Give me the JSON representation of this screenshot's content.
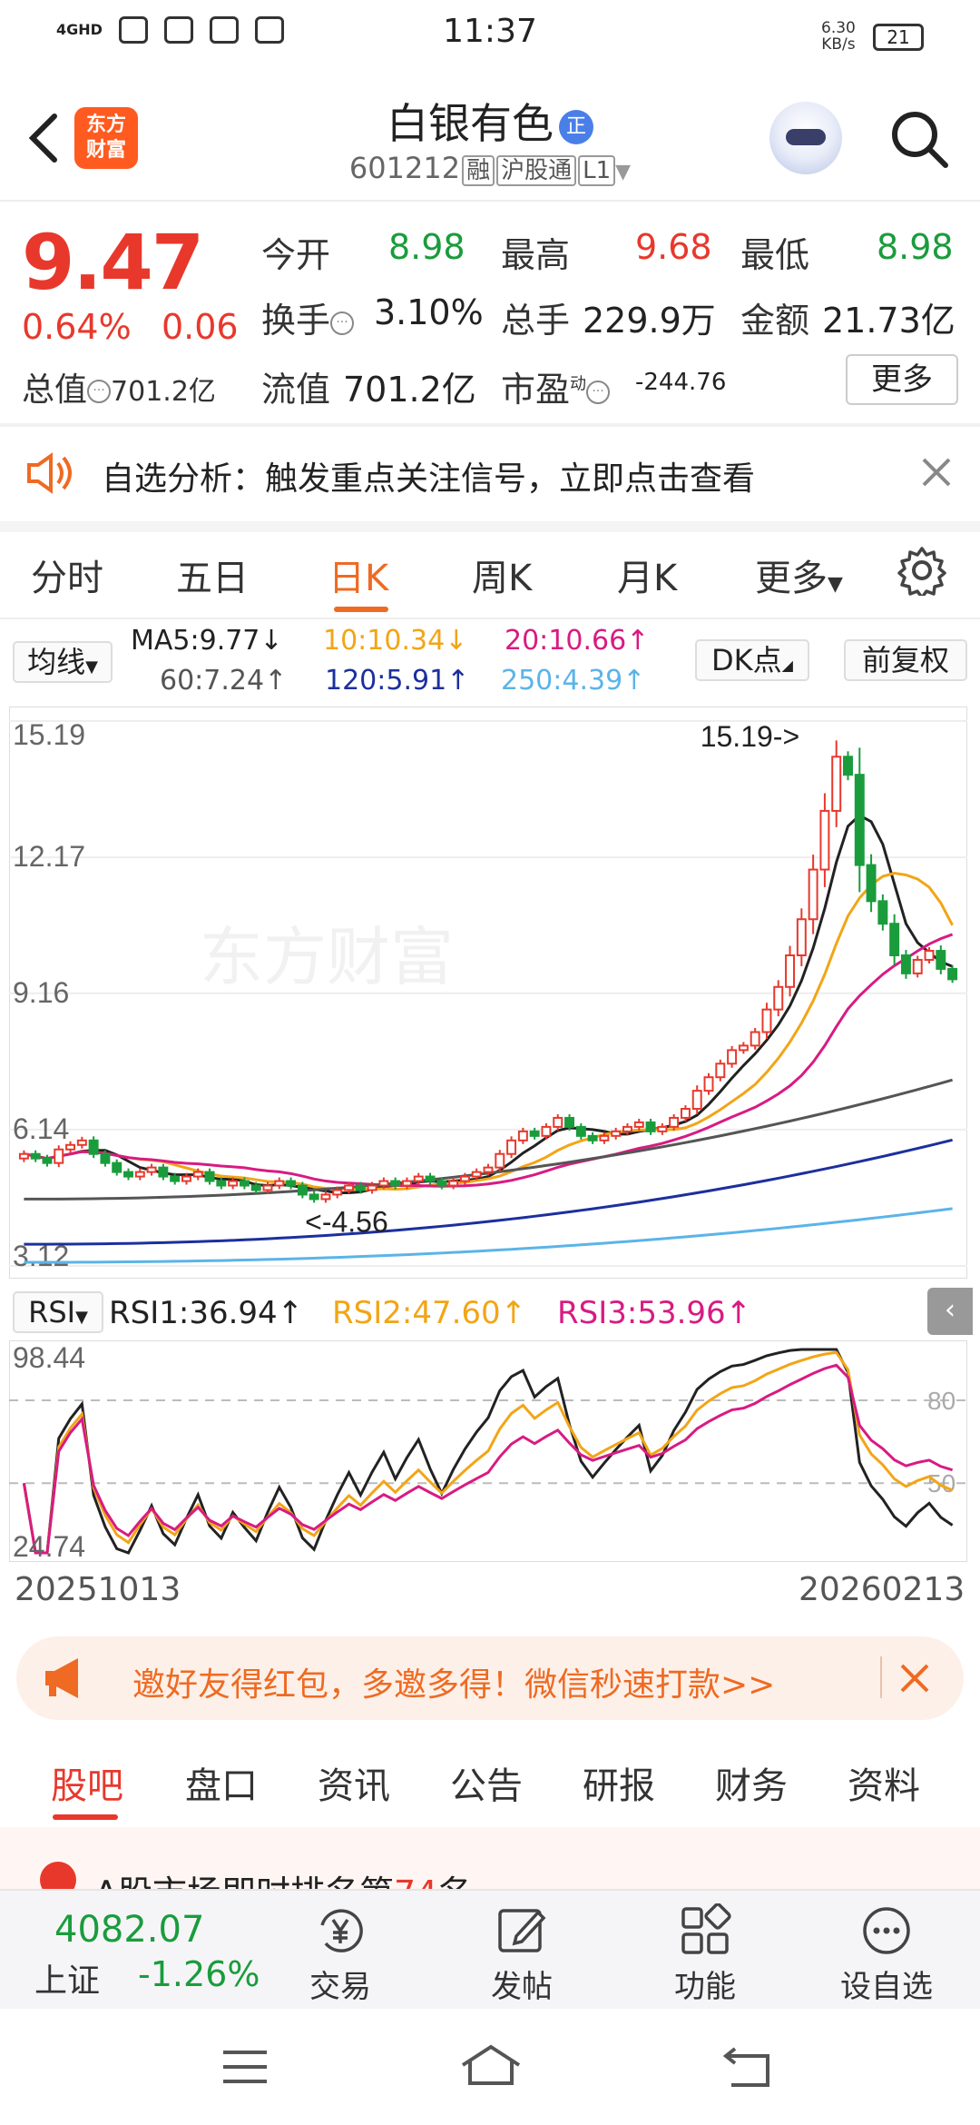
{
  "status_bar": {
    "time": "11:37",
    "net_speed": "6.30",
    "net_unit": "KB/s",
    "battery": "21",
    "signal": "4GHD"
  },
  "header": {
    "stock_name": "白银有色",
    "badge": "正",
    "code": "601212",
    "tags": [
      "融",
      "沪股通",
      "L1"
    ],
    "logo_text": [
      "东方",
      "财富"
    ]
  },
  "quote": {
    "price": "9.47",
    "change_pct": "0.64%",
    "change": "0.06",
    "rows": [
      [
        {
          "label": "今开",
          "value": "8.98",
          "color": "green"
        },
        {
          "label": "最高",
          "value": "9.68",
          "color": "red"
        },
        {
          "label": "最低",
          "value": "8.98",
          "color": "green"
        }
      ],
      [
        {
          "label": "换手",
          "value": "3.10%",
          "color": "dark"
        },
        {
          "label": "总手",
          "value": "229.9万",
          "color": "dark"
        },
        {
          "label": "金额",
          "value": "21.73亿",
          "color": "dark"
        }
      ],
      [
        {
          "label": "总值",
          "value": "701.2亿"
        },
        {
          "label": "流值",
          "value": "701.2亿"
        },
        {
          "label": "市盈",
          "value": "-244.76",
          "sup": "动"
        }
      ]
    ],
    "more_label": "更多"
  },
  "alert": {
    "text": "自选分析：触发重点关注信号，立即点击查看"
  },
  "tabs": {
    "items": [
      "分时",
      "五日",
      "日K",
      "周K",
      "月K",
      "更多"
    ],
    "active": "日K"
  },
  "ma": {
    "selector": "均线",
    "items": [
      {
        "text": "MA5:9.77",
        "arrow": "↓",
        "color": "#222"
      },
      {
        "text": "10:10.34",
        "arrow": "↓",
        "color": "#f2a516"
      },
      {
        "text": "20:10.66",
        "arrow": "↑",
        "color": "#d81b82"
      },
      {
        "text": "60:7.24",
        "arrow": "↑",
        "color": "#555555"
      },
      {
        "text": "120:5.91",
        "arrow": "↑",
        "color": "#1c2f9e"
      },
      {
        "text": "250:4.39",
        "arrow": "↑",
        "color": "#5bb4e8"
      }
    ],
    "dk_label": "DK点",
    "fq_label": "前复权"
  },
  "chart_data": [
    {
      "type": "candlestick",
      "title": "日K",
      "y_ticks": [
        "15.19",
        "12.17",
        "9.16",
        "6.14",
        "3.12"
      ],
      "ylim": [
        3.12,
        15.19
      ],
      "annotations": [
        "15.19->",
        "<-4.56"
      ],
      "x_range": [
        "20251013",
        "20260213"
      ],
      "closes": [
        5.6,
        5.5,
        5.4,
        5.7,
        5.8,
        5.9,
        5.6,
        5.4,
        5.2,
        5.1,
        5.2,
        5.3,
        5.1,
        5.0,
        5.1,
        5.2,
        5.0,
        4.9,
        5.0,
        4.9,
        4.8,
        4.9,
        5.0,
        4.9,
        4.7,
        4.6,
        4.7,
        4.8,
        4.9,
        4.8,
        4.9,
        5.0,
        4.9,
        5.0,
        5.1,
        5.0,
        4.9,
        5.0,
        5.1,
        5.2,
        5.3,
        5.6,
        5.9,
        6.1,
        6.0,
        6.2,
        6.4,
        6.2,
        6.0,
        5.9,
        6.0,
        6.1,
        6.2,
        6.3,
        6.1,
        6.2,
        6.4,
        6.6,
        7.0,
        7.3,
        7.6,
        7.9,
        8.0,
        8.3,
        8.8,
        9.3,
        10.0,
        10.8,
        11.9,
        13.2,
        14.4,
        14.0,
        12.0,
        11.2,
        10.7,
        10.0,
        9.6,
        9.9,
        10.1,
        9.7,
        9.47
      ]
    },
    {
      "type": "line",
      "title": "RSI",
      "series": [
        {
          "name": "RSI1",
          "last": "36.94"
        },
        {
          "name": "RSI2",
          "last": "47.60"
        },
        {
          "name": "RSI3",
          "last": "53.96"
        }
      ],
      "y_ticks": [
        "98.44",
        "24.74"
      ],
      "ref_lines": [
        80,
        50
      ],
      "ylim": [
        24.74,
        98.44
      ]
    }
  ],
  "rsi_header": {
    "selector": "RSI",
    "items": [
      {
        "text": "RSI1:36.94",
        "arrow": "↑",
        "color": "#222"
      },
      {
        "text": "RSI2:47.60",
        "arrow": "↑",
        "color": "#f2a516"
      },
      {
        "text": "RSI3:53.96",
        "arrow": "↑",
        "color": "#d81b82"
      }
    ]
  },
  "dates": {
    "start": "20251013",
    "end": "20260213"
  },
  "banner": {
    "text": "邀好友得红包，多邀多得！微信秒速打款>>"
  },
  "bottom_tabs": {
    "items": [
      "股吧",
      "盘口",
      "资讯",
      "公告",
      "研报",
      "财务",
      "资料"
    ],
    "active": "股吧"
  },
  "peek": {
    "text_before": "A股市场即时排名第",
    "rank": "74",
    "text_after": "名"
  },
  "bottom_nav": {
    "index_value": "4082.07",
    "index_name": "上证",
    "index_change": "-1.26%",
    "items": [
      {
        "label": "交易",
        "icon": "yen-icon"
      },
      {
        "label": "发帖",
        "icon": "edit-icon"
      },
      {
        "label": "功能",
        "icon": "grid-icon"
      },
      {
        "label": "设自选",
        "icon": "more-icon"
      }
    ]
  },
  "colors": {
    "up": "#e8382c",
    "down": "#1a9c3c",
    "accent": "#ef6a22"
  }
}
